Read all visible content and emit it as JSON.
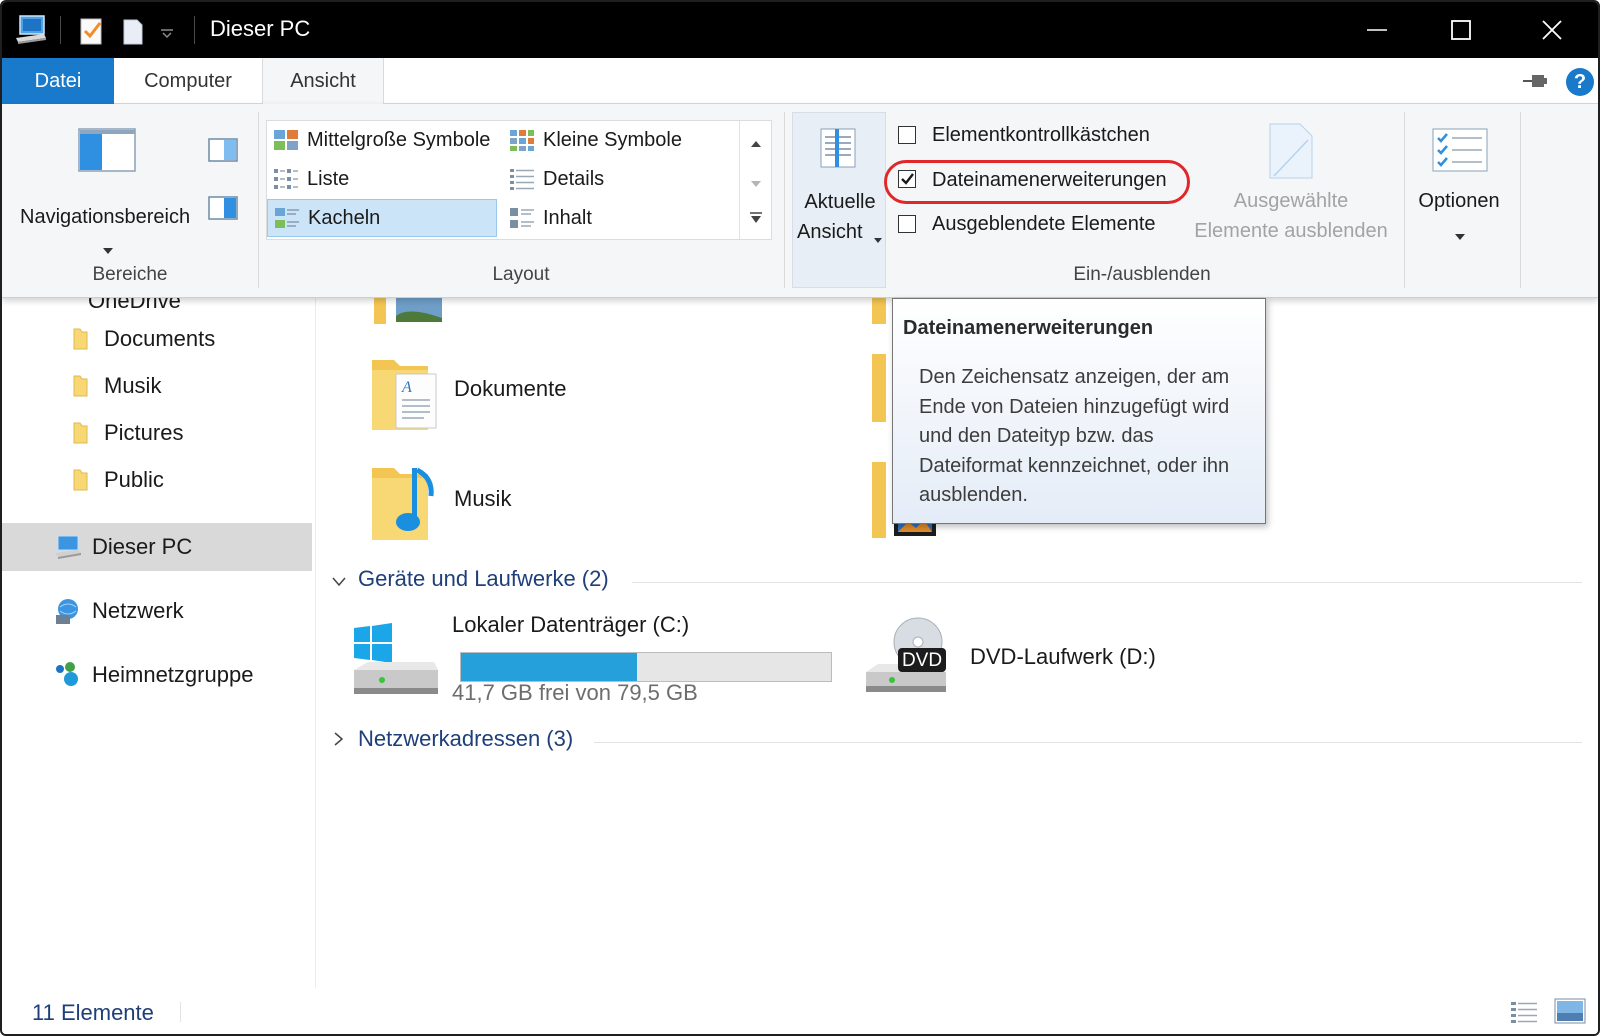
{
  "window": {
    "title": "Dieser PC"
  },
  "ribbon": {
    "tabs": [
      {
        "label": "Datei"
      },
      {
        "label": "Computer"
      },
      {
        "label": "Ansicht"
      }
    ],
    "help_label": "?",
    "groups": {
      "bereiche": {
        "label": "Bereiche",
        "nav_pane_label": "Navigationsbereich"
      },
      "layout": {
        "label": "Layout",
        "items": [
          {
            "label": "Mittelgroße Symbole",
            "selected": false
          },
          {
            "label": "Kleine Symbole",
            "selected": false
          },
          {
            "label": "Liste",
            "selected": false
          },
          {
            "label": "Details",
            "selected": false
          },
          {
            "label": "Kacheln",
            "selected": true
          },
          {
            "label": "Inhalt",
            "selected": false
          }
        ]
      },
      "current_view": {
        "line1": "Aktuelle",
        "line2": "Ansicht"
      },
      "show_hide": {
        "label": "Ein-/ausblenden",
        "checkboxes": [
          {
            "label": "Elementkontrollkästchen",
            "checked": false
          },
          {
            "label": "Dateinamenerweiterungen",
            "checked": true
          },
          {
            "label": "Ausgeblendete Elemente",
            "checked": false
          }
        ],
        "hide_selected_line1": "Ausgewählte",
        "hide_selected_line2": "Elemente ausblenden"
      },
      "options": {
        "label": "Optionen"
      }
    }
  },
  "tooltip": {
    "title": "Dateinamenerweiterungen",
    "body": "Den Zeichensatz anzeigen, der am Ende von Dateien hinzugefügt wird und den Dateityp bzw. das Dateiformat kennzeichnet, oder ihn ausblenden."
  },
  "sidebar": {
    "partial_item": "OneDrive",
    "items": [
      {
        "label": "Documents"
      },
      {
        "label": "Musik"
      },
      {
        "label": "Pictures"
      },
      {
        "label": "Public"
      }
    ],
    "this_pc": "Dieser PC",
    "network": "Netzwerk",
    "homegroup": "Heimnetzgruppe"
  },
  "content": {
    "folders": [
      {
        "name": "Dokumente"
      },
      {
        "name": "Musik"
      }
    ],
    "devices_section": "Geräte und Laufwerke (2)",
    "drives": [
      {
        "name": "Lokaler Datenträger (C:)",
        "free_text": "41,7 GB frei von 79,5 GB",
        "used_fraction": 0.475
      },
      {
        "name": "DVD-Laufwerk (D:)",
        "badge": "DVD"
      }
    ],
    "network_section": "Netzwerkadressen (3)"
  },
  "statusbar": {
    "count": "11 Elemente"
  },
  "colors": {
    "accent": "#1979ca",
    "highlight_ring": "#e0282a",
    "progress": "#26a0da",
    "section_text": "#1e3f7a"
  }
}
